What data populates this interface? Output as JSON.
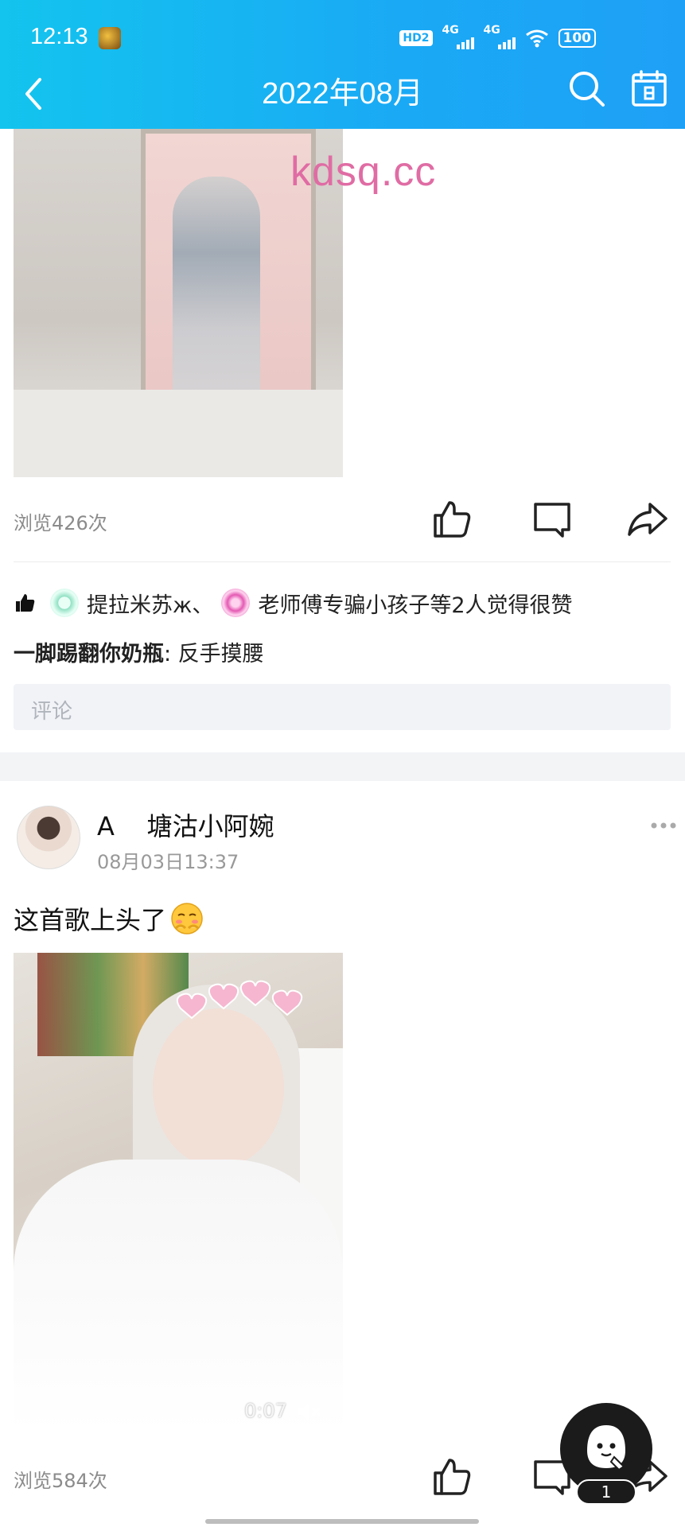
{
  "status_bar": {
    "time": "12:13",
    "network_labels": [
      "HD2",
      "4G",
      "4G"
    ],
    "battery": "100"
  },
  "nav": {
    "title": "2022年08月",
    "icons": [
      "back-arrow-icon",
      "search-icon",
      "calendar-icon"
    ]
  },
  "watermark": "kdsq.cc",
  "post1": {
    "views": "浏览426次",
    "likes_text_1": "提拉米苏ж、",
    "likes_text_2": "老师傅专骗小孩子等2人觉得很赞",
    "comment_author": "一脚踢翻你奶瓶",
    "comment_sep": ": ",
    "comment_text": "反手摸腰",
    "comment_placeholder": "评论"
  },
  "post2": {
    "username": "A    塘沽小阿婉",
    "time": "08月03日13:37",
    "text": "这首歌上头了",
    "video_duration": "0:07",
    "views": "浏览584次"
  },
  "floating": {
    "badge": "1"
  },
  "colors": {
    "header_gradient_start": "#13c4ee",
    "header_gradient_end": "#1ea0f6",
    "watermark": "#e06ca4",
    "muted_text": "#8b8b8b"
  }
}
